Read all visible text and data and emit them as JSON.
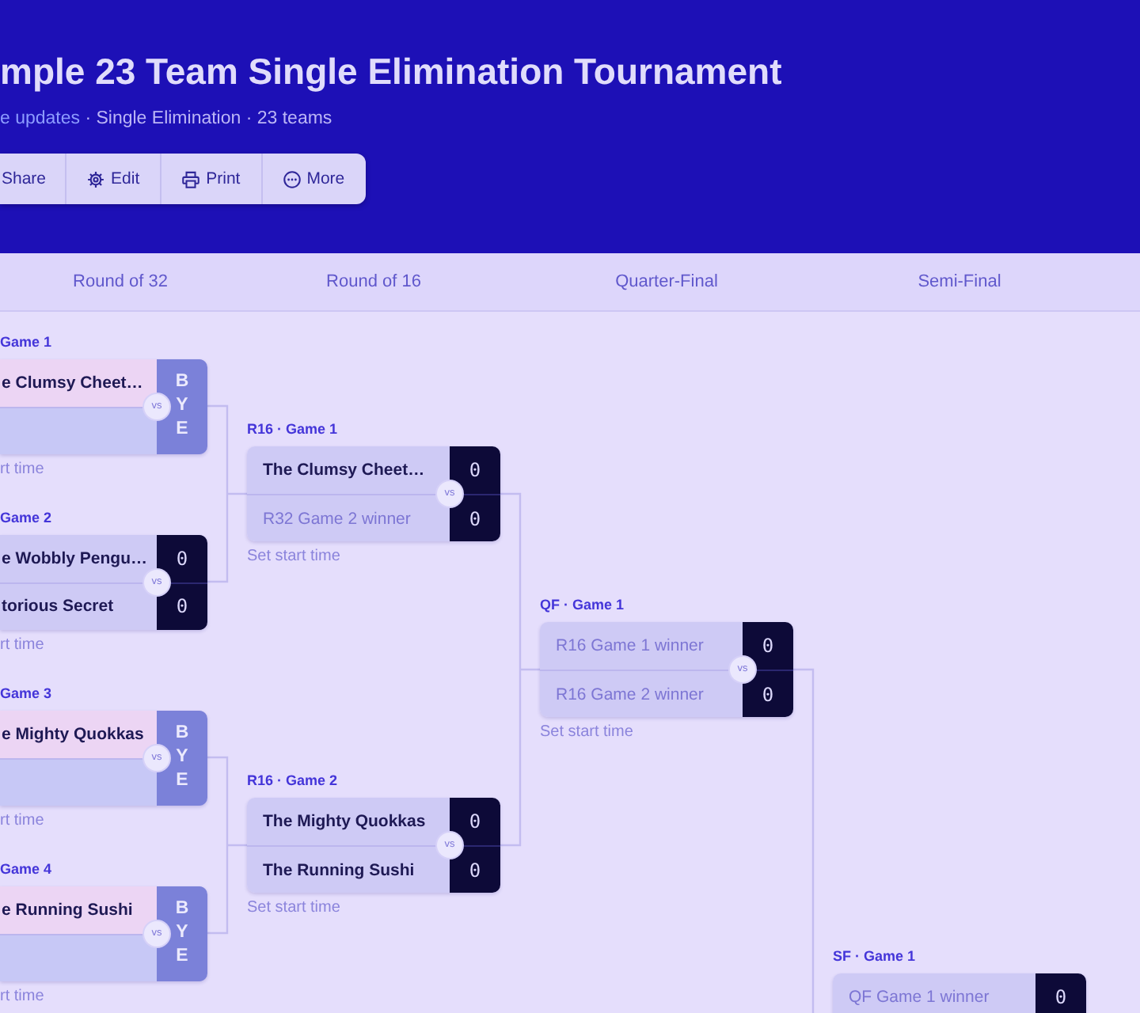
{
  "header": {
    "title": "mple 23 Team Single Elimination Tournament",
    "meta": {
      "link": "e updates",
      "text": " · Single Elimination · 23 teams"
    },
    "toolbar": [
      {
        "label": "Share",
        "kind": "share"
      },
      {
        "label": "Edit",
        "kind": "edit"
      },
      {
        "label": "Print",
        "kind": "print"
      },
      {
        "label": "More",
        "kind": "more"
      }
    ]
  },
  "rounds": [
    {
      "title": "Round of 32",
      "games": [
        {
          "label": "Game 1",
          "teams": [
            {
              "kind": "team",
              "name": "e Clumsy Cheet…",
              "advanced": true
            },
            {
              "kind": "empty",
              "advanced": false
            }
          ],
          "bye": "BYE",
          "vs": "vs",
          "start_time": "rt time"
        },
        {
          "label": "Game 2",
          "teams": [
            {
              "kind": "team",
              "name": "e Wobbly Pengu…",
              "advanced": false,
              "score": "0"
            },
            {
              "kind": "team",
              "name": "torious Secret",
              "advanced": false,
              "score": "0"
            }
          ],
          "vs": "vs",
          "start_time": "rt time"
        },
        {
          "label": "Game 3",
          "teams": [
            {
              "kind": "team",
              "name": "e Mighty Quokkas",
              "advanced": true
            },
            {
              "kind": "empty",
              "advanced": false
            }
          ],
          "bye": "BYE",
          "vs": "vs",
          "start_time": "rt time"
        },
        {
          "label": "Game 4",
          "teams": [
            {
              "kind": "team",
              "name": "e Running Sushi",
              "advanced": true
            },
            {
              "kind": "empty",
              "advanced": false
            }
          ],
          "bye": "BYE",
          "vs": "vs",
          "start_time": "rt time"
        }
      ]
    },
    {
      "title": "Round of 16",
      "games": [
        {
          "label": "R16 · Game 1",
          "teams": [
            {
              "kind": "team",
              "name": "The Clumsy Cheet…",
              "advanced": false,
              "score": "0"
            },
            {
              "kind": "pending",
              "name": "R32 Game 2 winner",
              "advanced": false,
              "score": "0"
            }
          ],
          "vs": "vs",
          "start_time": "Set start time"
        },
        {
          "label": "R16 · Game 2",
          "teams": [
            {
              "kind": "team",
              "name": "The Mighty Quokkas",
              "advanced": false,
              "score": "0"
            },
            {
              "kind": "team",
              "name": "The Running Sushi",
              "advanced": false,
              "score": "0"
            }
          ],
          "vs": "vs",
          "start_time": "Set start time"
        }
      ]
    },
    {
      "title": "Quarter-Final",
      "games": [
        {
          "label": "QF · Game 1",
          "teams": [
            {
              "kind": "pending",
              "name": "R16 Game 1 winner",
              "advanced": false,
              "score": "0"
            },
            {
              "kind": "pending",
              "name": "R16 Game 2 winner",
              "advanced": false,
              "score": "0"
            }
          ],
          "vs": "vs",
          "start_time": "Set start time"
        }
      ]
    },
    {
      "title": "Semi-Final",
      "games": [
        {
          "label": "SF · Game 1",
          "teams": [
            {
              "kind": "pending",
              "name": "QF Game 1 winner",
              "advanced": false,
              "score": "0"
            }
          ]
        }
      ]
    }
  ]
}
